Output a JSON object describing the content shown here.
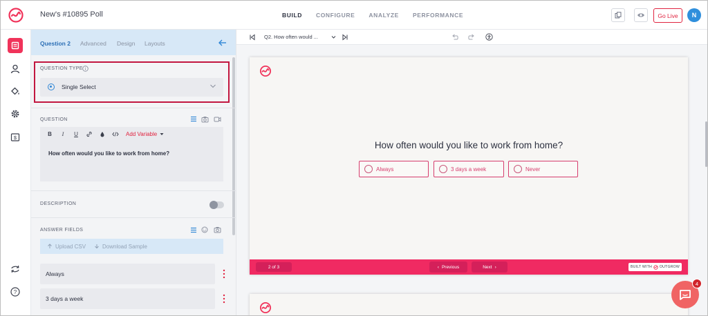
{
  "app": {
    "title": "New's #10895 Poll"
  },
  "nav": {
    "build": "BUILD",
    "configure": "CONFIGURE",
    "analyze": "ANALYZE",
    "performance": "PERFORMANCE",
    "active": "BUILD"
  },
  "header_actions": {
    "go_live": "Go Live",
    "avatar_initial": "N"
  },
  "panel": {
    "tabs": {
      "question": "Question 2",
      "advanced": "Advanced",
      "design": "Design",
      "layouts": "Layouts"
    },
    "question_type": {
      "label": "QUESTION TYPE",
      "value": "Single Select"
    },
    "question": {
      "label": "QUESTION",
      "toolbar": {
        "bold": "B",
        "italic": "I",
        "underline": "U",
        "add_variable": "Add Variable"
      },
      "text": "How often would you like to work from home?"
    },
    "description": {
      "label": "DESCRIPTION",
      "enabled": false
    },
    "answer_fields": {
      "label": "ANSWER FIELDS",
      "upload_csv": "Upload CSV",
      "download_sample": "Download Sample",
      "items": [
        "Always",
        "3 days a week"
      ]
    }
  },
  "preview": {
    "question_select": "Q2. How often would ...",
    "question": "How often would you like to work from home?",
    "options": [
      "Always",
      "3 days a week",
      "Never"
    ],
    "page_indicator": "2 of 3",
    "previous": "Previous",
    "next": "Next",
    "built_with": "BUILT WITH",
    "brand": "OUTGROW"
  },
  "chat": {
    "badge_count": "4"
  },
  "colors": {
    "brand": "#f0335a",
    "accent_blue": "#2e86d6",
    "footer": "#f02a62",
    "option_border": "#d63c6d"
  }
}
